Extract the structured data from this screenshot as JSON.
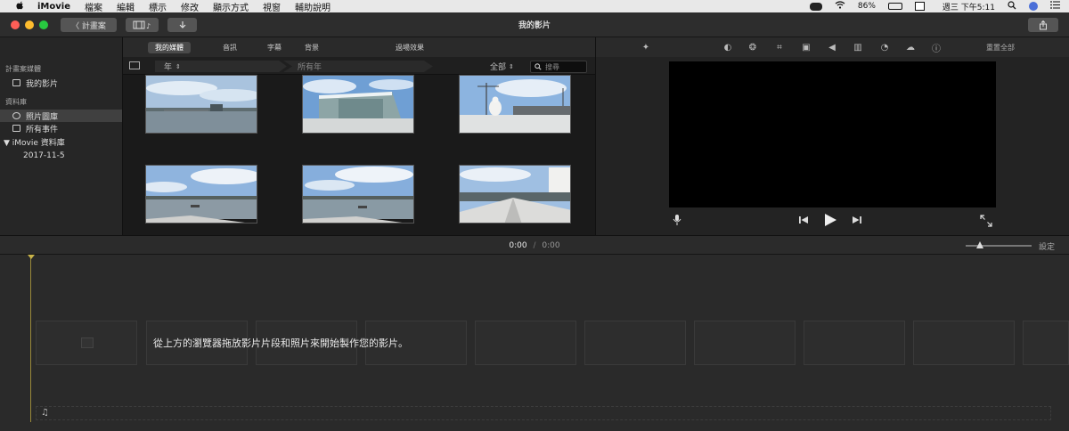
{
  "menubar": {
    "apple": "",
    "items": [
      "iMovie",
      "檔案",
      "編輯",
      "標示",
      "修改",
      "顯示方式",
      "視窗",
      "輔助說明"
    ],
    "status": {
      "battery": "86%",
      "clock": "週三 下午5:11"
    }
  },
  "toolbar": {
    "back_label": "〈 計畫案",
    "window_title": "我的影片"
  },
  "sidebar": {
    "projects_header": "計畫案媒體",
    "project_item": "我的影片",
    "libraries_header": "資料庫",
    "photos_item": "照片圖庫",
    "all_events_item": "所有事件",
    "library_item": "▼ iMovie 資料庫",
    "event_item": "2017-11-5"
  },
  "tabs": [
    "我的媒體",
    "音訊",
    "字幕",
    "背景",
    "過場效果"
  ],
  "filter": {
    "year": "年",
    "all_years": "所有年",
    "all": "全部",
    "search_placeholder": "搜尋"
  },
  "viewer": {
    "reset_all": "重置全部"
  },
  "timeline": {
    "timecode_current": "0:00",
    "timecode_sep": "/",
    "timecode_total": "0:00",
    "settings": "設定",
    "hint": "從上方的瀏覽器拖放影片片段和照片來開始製作您的影片。"
  },
  "colors": {
    "accent": "#4a4a4a",
    "playhead": "#c9b44a",
    "sky": "#8fb4de"
  }
}
